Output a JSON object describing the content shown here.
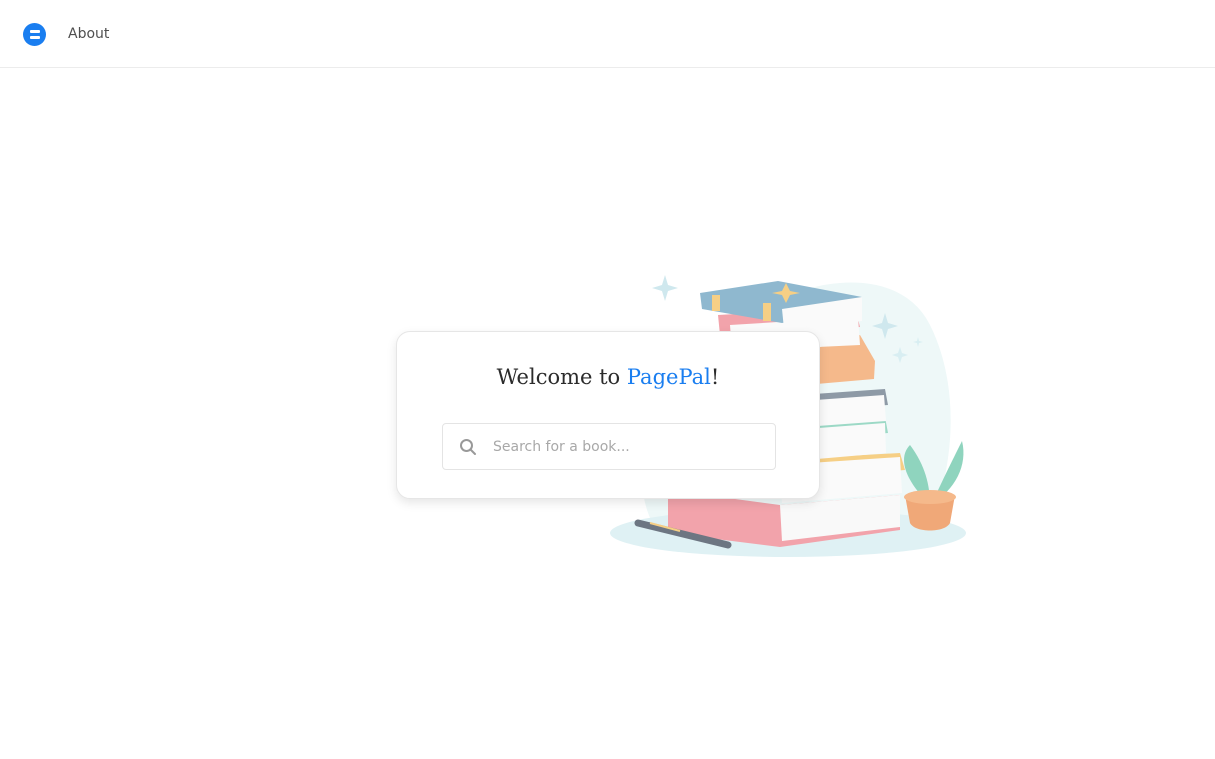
{
  "nav": {
    "logo_icon": "pagepal-logo-icon",
    "about_label": "About"
  },
  "hero": {
    "illustration": "book-stack-with-plant-illustration",
    "title_prefix": "Welcome to ",
    "title_brand": "PagePal",
    "title_suffix": "!",
    "search": {
      "icon": "search-icon",
      "placeholder": "Search for a book...",
      "value": ""
    }
  },
  "colors": {
    "accent": "#1a7ef0",
    "text": "#2b2b2b",
    "muted": "#a8a8a8",
    "border": "#e4e4e4"
  }
}
